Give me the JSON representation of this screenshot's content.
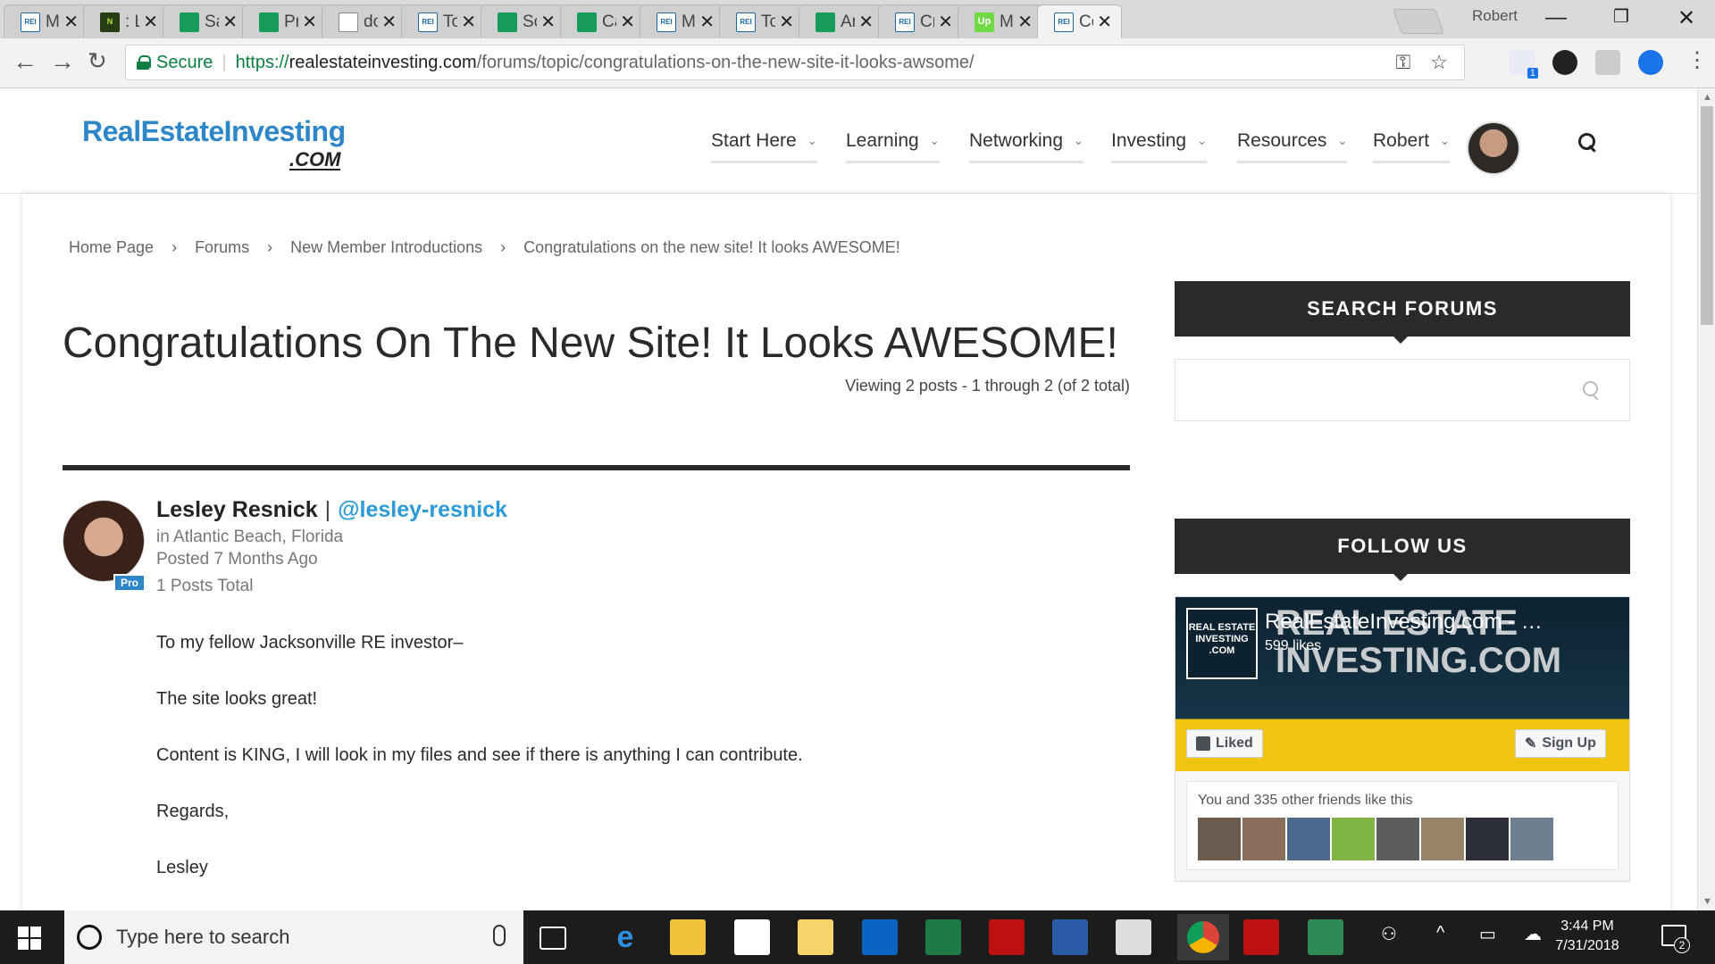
{
  "browser": {
    "tabs": [
      {
        "title": "Me",
        "icon": "rei"
      },
      {
        "title": ": Li",
        "icon": "lime"
      },
      {
        "title": "Sa",
        "icon": "sheet"
      },
      {
        "title": "Pro",
        "icon": "sheet"
      },
      {
        "title": "do",
        "icon": "doc"
      },
      {
        "title": "To",
        "icon": "rei"
      },
      {
        "title": "So",
        "icon": "sheet"
      },
      {
        "title": "Ca",
        "icon": "sheet"
      },
      {
        "title": "Me",
        "icon": "rei"
      },
      {
        "title": "To",
        "icon": "rei"
      },
      {
        "title": "An",
        "icon": "sheet"
      },
      {
        "title": "Cre",
        "icon": "rei"
      },
      {
        "title": "Me",
        "icon": "up"
      },
      {
        "title": "Co",
        "icon": "rei",
        "active": true
      }
    ],
    "profile": "Robert",
    "secure_label": "Secure",
    "url_scheme": "https://",
    "url_host": "realestateinvesting.com",
    "url_path": "/forums/topic/congratulations-on-the-new-site-it-looks-awsome/",
    "extension_badge": "1"
  },
  "site": {
    "logo_main": "RealEstateInvesting",
    "logo_com": ".COM",
    "nav": [
      "Start Here",
      "Learning",
      "Networking",
      "Investing",
      "Resources",
      "Robert"
    ]
  },
  "breadcrumb": [
    "Home Page",
    "Forums",
    "New Member Introductions",
    "Congratulations on the new site! It looks AWESOME!"
  ],
  "breadcrumb_sep": "›",
  "topic": {
    "title": "Congratulations On The New Site! It Looks AWESOME!",
    "viewing": "Viewing 2 posts - 1 through 2 (of 2 total)"
  },
  "post": {
    "author": "Lesley Resnick",
    "separator": "|",
    "handle": "@lesley-resnick",
    "badge": "Pro",
    "location": "in Atlantic Beach, Florida",
    "posted": "Posted 7 Months Ago",
    "total": "1 Posts Total",
    "body": [
      "To my fellow Jacksonville RE investor–",
      "The site looks great!",
      "Content is KING, I will look in my files and see if there is anything I can contribute.",
      "Regards,",
      "Lesley"
    ]
  },
  "sidebar": {
    "search_title": "SEARCH FORUMS",
    "follow_title": "FOLLOW US",
    "fb_page_name": "RealEstateInvesting.com - …",
    "fb_likes": "599 likes",
    "fb_logo_text": "REAL ESTATE INVESTING .COM",
    "fb_cover_text": "REAL ESTATE INVESTING.COM",
    "fb_liked": "Liked",
    "fb_signup": "Sign Up",
    "fb_friends_text": "You and 335 other friends like this"
  },
  "taskbar": {
    "search_placeholder": "Type here to search",
    "time": "3:44 PM",
    "date": "7/31/2018",
    "notifications": "2"
  }
}
